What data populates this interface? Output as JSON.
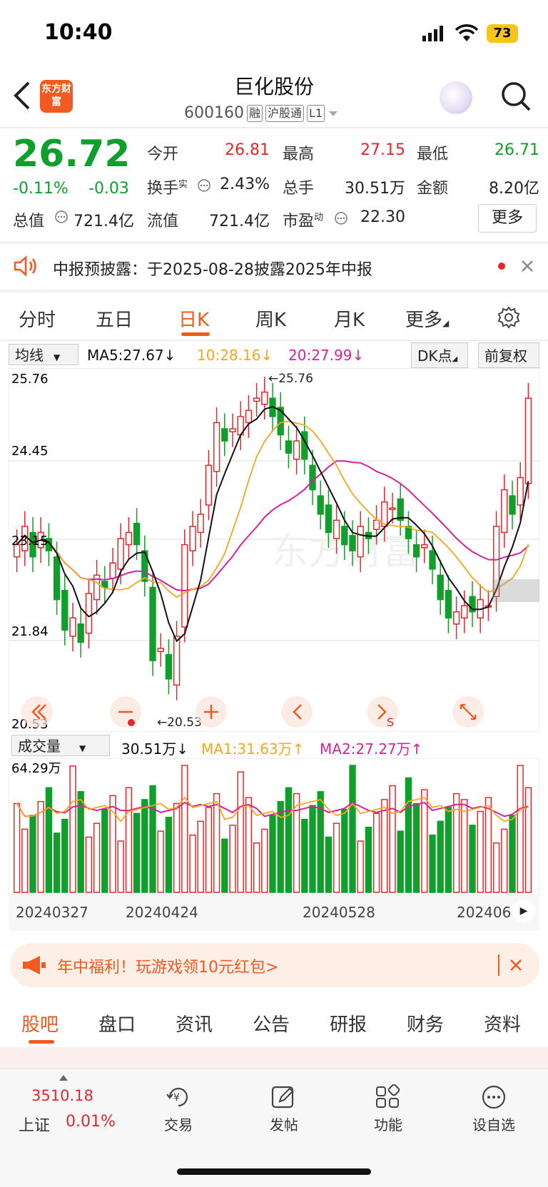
{
  "status_bar": {
    "time": "10:40",
    "battery": "73"
  },
  "header": {
    "stock_name": "巨化股份",
    "code": "600160",
    "tag_margin": "融",
    "tag_connect": "沪股通",
    "tag_level": "L1",
    "logo_text": "东方财富"
  },
  "quote": {
    "price": "26.72",
    "change_pct": "-0.11%",
    "change_abs": "-0.03",
    "open_label": "今开",
    "open": "26.81",
    "high_label": "最高",
    "high": "27.15",
    "low_label": "最低",
    "low": "26.71",
    "turnover_label": "换手",
    "turnover_sup": "实",
    "turnover": "2.43%",
    "volume_label": "总手",
    "volume": "30.51万",
    "amount_label": "金额",
    "amount": "8.20亿",
    "total_mv_label": "总值",
    "total_mv": "721.4亿",
    "float_mv_label": "流值",
    "float_mv": "721.4亿",
    "pe_label": "市盈",
    "pe_sup": "动",
    "pe": "22.30",
    "more_button": "更多"
  },
  "notice": {
    "text": "中报预披露：于2025-08-28披露2025年中报"
  },
  "tabs": [
    "分时",
    "五日",
    "日K",
    "周K",
    "月K",
    "更多"
  ],
  "kline_header": {
    "indicator": "均线",
    "ma5": "MA5:27.67↓",
    "ma10": "10:28.16↓",
    "ma20": "20:27.99↓",
    "dk_button": "DK点",
    "adjust_button": "前复权"
  },
  "kline_axis": {
    "y_labels": [
      "25.76",
      "24.45",
      "23.15",
      "21.84",
      "20.53"
    ],
    "max_mark": "←25.76",
    "min_mark": "←20.53"
  },
  "volume_header": {
    "indicator": "成交量",
    "vol": "30.51万↓",
    "ma1": "MA1:31.63万↑",
    "ma2": "MA2:27.27万↑",
    "y_max": "64.29万"
  },
  "date_axis": [
    "20240327",
    "20240424",
    "20240528",
    "202406"
  ],
  "colors": {
    "up": "#e4282c",
    "down": "#109e2c",
    "accent": "#f25a1f",
    "ma5": "#111111",
    "ma10": "#f5a623",
    "ma20": "#d6239b"
  },
  "promo": {
    "text": "年中福利！玩游戏领10元红包>"
  },
  "bottom_tabs": [
    "股吧",
    "盘口",
    "资讯",
    "公告",
    "研报",
    "财务",
    "资料"
  ],
  "bottom_nav": {
    "index_value": "3510.18",
    "index_name": "上证",
    "index_change": "0.01%",
    "items": [
      "交易",
      "发帖",
      "功能",
      "设自选"
    ]
  }
}
